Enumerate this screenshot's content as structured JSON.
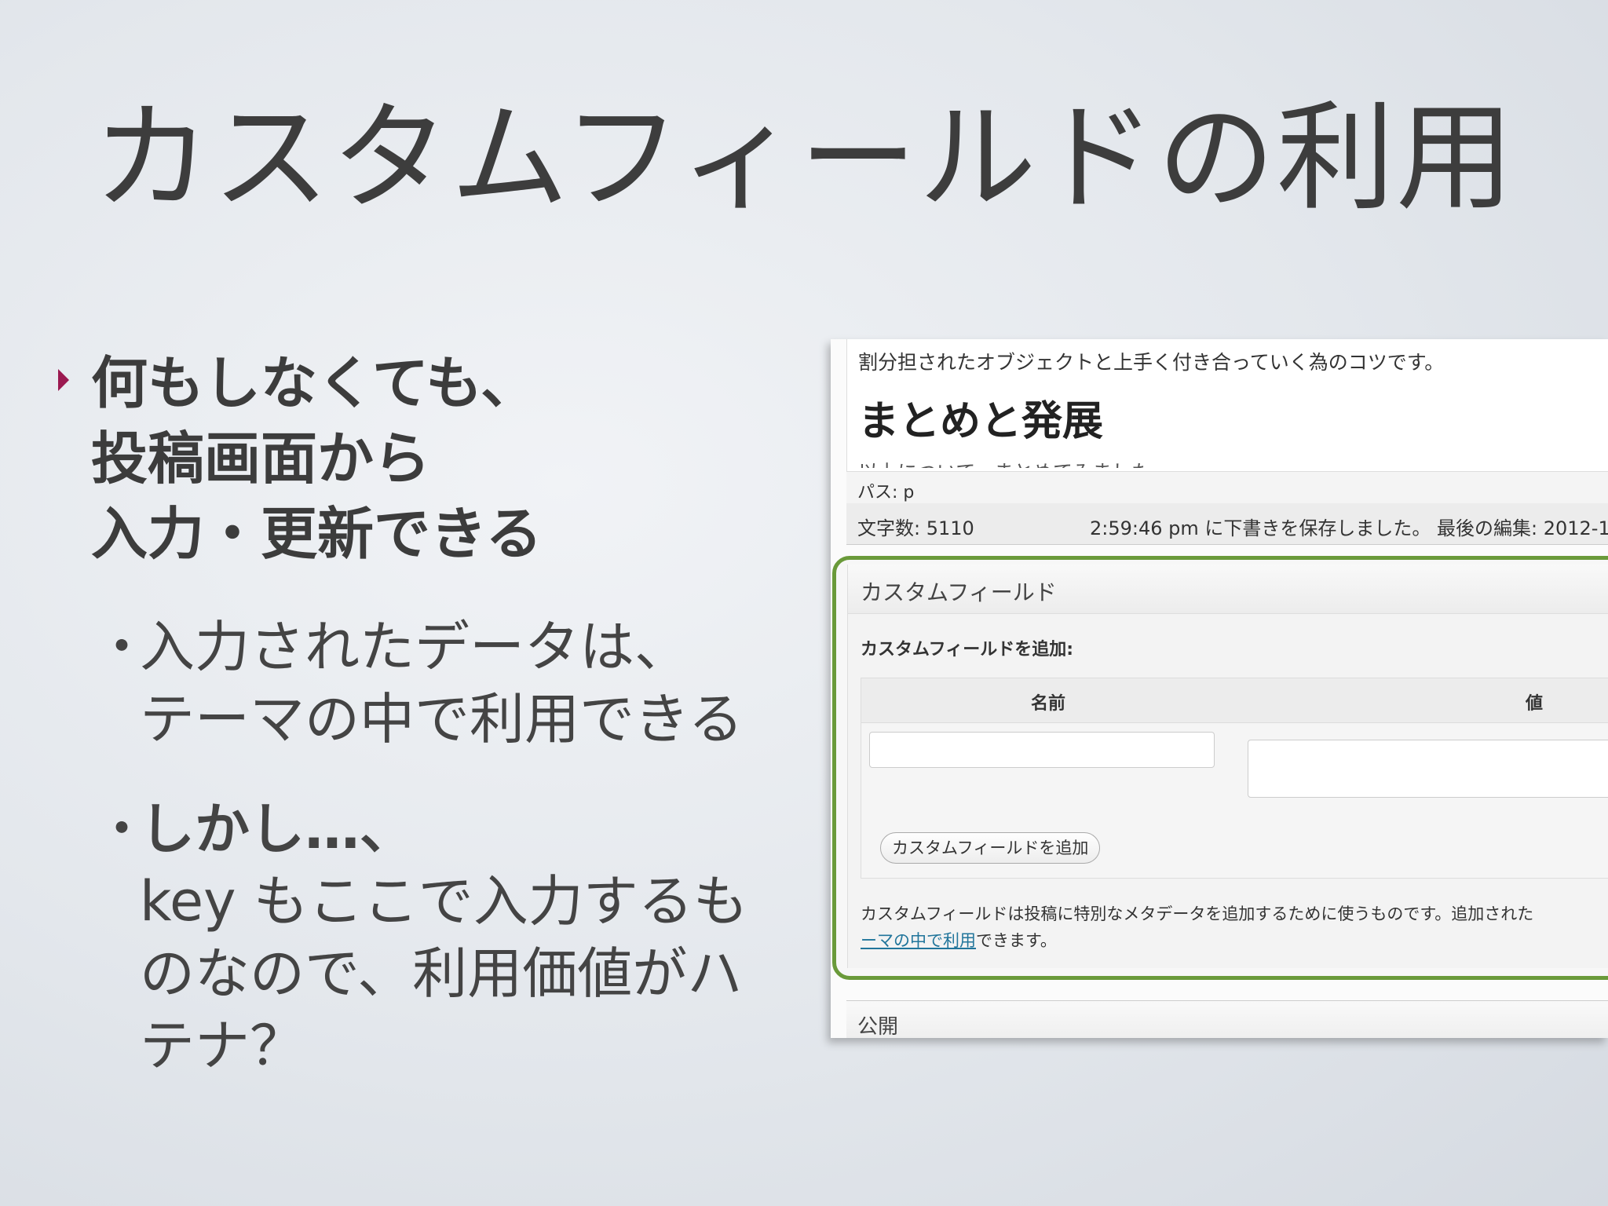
{
  "slide": {
    "title": "カスタムフィールドの利用",
    "bullet_main": [
      "何もしなくても、",
      "投稿画面から",
      "入力・更新できる"
    ],
    "sub_bullets": [
      {
        "dot": "・",
        "lines": [
          "入力されたデータは、",
          "テーマの中で利用できる"
        ]
      },
      {
        "dot": "・",
        "bold_line": "しかし…、",
        "lines": [
          "key もここで入力するも",
          "のなので、利用価値がハ",
          "テナ？"
        ]
      }
    ]
  },
  "screenshot": {
    "editor": {
      "intro_text": "割分担されたオブジェクトと上手く付き合っていく為のコツです。",
      "heading": "まとめと発展",
      "cut_text": "以上について、まとめてみました"
    },
    "path_bar": "パス: p",
    "status": {
      "word_count": "文字数: 5110",
      "saved_text": "2:59:46 pm に下書きを保存しました。 最後の編集: 2012-1"
    },
    "custom_fields": {
      "header": "カスタムフィールド",
      "add_label": "カスタムフィールドを追加:",
      "col_name": "名前",
      "col_value": "値",
      "name_value": "",
      "value_value": "",
      "add_button": "カスタムフィールドを追加",
      "desc_line1": "カスタムフィールドは投稿に特別なメタデータを追加するために使うものです。追加された",
      "desc_link": "ーマの中で利用",
      "desc_line2_rest": "できます。"
    },
    "publish_header": "公開"
  },
  "colors": {
    "bullet_marker": "#9b1950",
    "highlight_border": "#6a9a3a",
    "link": "#21759b"
  }
}
